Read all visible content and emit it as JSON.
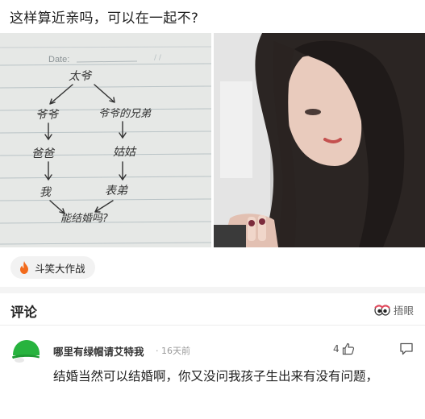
{
  "post": {
    "title": "这样算近亲吗，可以在一起不?"
  },
  "images": {
    "left": {
      "icon": "notebook-handwriting-image",
      "date_label": "Date:",
      "nodes": [
        "太爷",
        "爷爷",
        "爷爷的兄弟",
        "爸爸",
        "姑姑",
        "我",
        "表弟",
        "能结婚吗?"
      ]
    },
    "right": {
      "icon": "woman-portrait-photo"
    }
  },
  "tag": {
    "icon": "fire-icon",
    "label": "斗笑大作战",
    "color": "#f26a1b"
  },
  "comments": {
    "title": "评论",
    "hide_label": "捂眼",
    "items": [
      {
        "username": "哪里有绿帽请艾特我",
        "time": "· 16天前",
        "likes": "4",
        "avatar_color": "#27b33e",
        "text": "结婚当然可以结婚啊，你又没问我孩子生出来有没有问题，"
      }
    ]
  }
}
